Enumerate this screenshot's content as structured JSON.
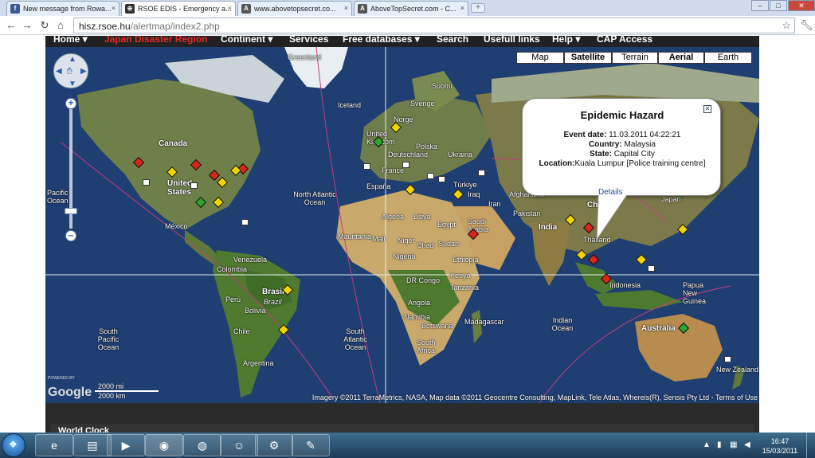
{
  "browser": {
    "tabs": [
      {
        "title": "New message from Rowa...",
        "active": false,
        "favicon_letter": "f",
        "favicon_color": "#3b5998"
      },
      {
        "title": "RSOE EDIS - Emergency a...",
        "active": true,
        "favicon_letter": "⊕",
        "favicon_color": "#333333"
      },
      {
        "title": "www.abovetopsecret.co...",
        "active": false,
        "favicon_letter": "A",
        "favicon_color": "#555555"
      },
      {
        "title": "AboveTopSecret.com - C...",
        "active": false,
        "favicon_letter": "A",
        "favicon_color": "#555555"
      }
    ],
    "new_tab_label": "+",
    "window_controls": {
      "minimize": "–",
      "maximize": "□",
      "close": "✕"
    },
    "url_host": "hisz.rsoe.hu",
    "url_path": "/alertmap/index2.php",
    "back_icon": "arrow-left-icon",
    "forward_icon": "arrow-right-icon",
    "reload_icon": "reload-icon",
    "home_icon": "home-icon"
  },
  "site_nav": [
    {
      "label": "Home ▾",
      "color": "#ffffff"
    },
    {
      "label": "Japan Disaster Region",
      "color": "#e32b2b"
    },
    {
      "label": "Continent ▾",
      "color": "#ffffff"
    },
    {
      "label": "Services",
      "color": "#ffffff"
    },
    {
      "label": "Free databases ▾",
      "color": "#ffffff"
    },
    {
      "label": "Search",
      "color": "#ffffff"
    },
    {
      "label": "Usefull links",
      "color": "#ffffff"
    },
    {
      "label": "Help ▾",
      "color": "#ffffff"
    },
    {
      "label": "CAP Access",
      "color": "#ffffff"
    }
  ],
  "map": {
    "map_types": [
      {
        "label": "Map",
        "active": false
      },
      {
        "label": "Satellite",
        "active": true
      },
      {
        "label": "Terrain",
        "active": false
      },
      {
        "label": "Aerial",
        "active": true
      },
      {
        "label": "Earth",
        "active": false
      }
    ],
    "zoom_in": "+",
    "zoom_out": "–",
    "places": {
      "greenland": "Greenland",
      "iceland": "Iceland",
      "sverige": "Sverige",
      "norge": "Norge",
      "suomi": "Suomi",
      "canada": "Canada",
      "united_kingdom": "United Kingdom",
      "deutschland": "Deutschland",
      "polska": "Polska",
      "ukraina": "Ukraina",
      "france": "France",
      "espana": "España",
      "turkiye": "Türkiye",
      "united_states": "United States",
      "pacific_ocean": "Pacific Ocean",
      "north_atlantic_ocean": "North Atlantic Ocean",
      "mexico": "México",
      "algeria": "Algeria",
      "libya": "Libya",
      "egypt": "Egypt",
      "saudi_arabia": "Saudi Arabia",
      "iraq": "Iraq",
      "iran": "Iran",
      "afghanistan": "Afghanistan",
      "pakistan": "Pakistan",
      "india": "India",
      "china": "China",
      "japan": "Japan",
      "mauritania": "Mauritania",
      "mali": "Mali",
      "niger": "Niger",
      "chad": "Chad",
      "sudan": "Sudan",
      "ethiopia": "Ethiopia",
      "nigeria": "Nigeria",
      "kenya": "Kenya",
      "tanzania": "Tanzania",
      "dr_congo": "DR Congo",
      "angola": "Angola",
      "namibia": "Namibia",
      "botswana": "Botswana",
      "south_africa": "South Africa",
      "madagascar": "Madagascar",
      "venezuela": "Venezuela",
      "colombia": "Colombia",
      "peru": "Perú",
      "bolivia": "Bolivia",
      "brasil": "Brasil",
      "brazil": "Brazil",
      "chile": "Chile",
      "argentina": "Argentina",
      "south_pacific_ocean": "South Pacific Ocean",
      "south_atlantic_ocean": "South Atlantic Ocean",
      "indian_ocean": "Indian Ocean",
      "thailand": "Thailand",
      "indonesia": "Indonesia",
      "papua_new_guinea": "Papua New Guinea",
      "australia": "Australia",
      "new_zealand": "New Zealand"
    },
    "infowindow": {
      "title": "Epidemic Hazard",
      "event_date_label": "Event date:",
      "event_date": "11.03.2011 04:22:21",
      "country_label": "Country:",
      "country": "Malaysia",
      "state_label": "State:",
      "state": "Capital City",
      "location_label": "Location:",
      "location": "Kuala Lumpur [Police training centre]",
      "details": "Details",
      "close_icon": "close-icon"
    },
    "markers": {
      "red": "#d8261c",
      "yellow": "#f2d500",
      "green": "#2fa52c",
      "info": "#ffffff"
    },
    "scale_top": "2000 mi",
    "scale_bottom": "2000 km",
    "powered_by": "POWERED BY",
    "google": "Google",
    "attribution": "Imagery ©2011 TerraMetrics, NASA, Map data ©2011 Geocentre Consulting, MapLink, Tele Atlas, Whereis(R), Sensis Pty Ltd - Terms of Use"
  },
  "below": {
    "world_clock": "World Clock"
  },
  "taskbar": {
    "start_icon": "windows-start-icon",
    "apps": [
      {
        "icon": "ie-icon",
        "glyph": "e"
      },
      {
        "icon": "explorer-icon",
        "glyph": "▤"
      },
      {
        "icon": "media-player-icon",
        "glyph": "▶"
      },
      {
        "icon": "chrome-icon",
        "glyph": "◉"
      },
      {
        "icon": "tor-icon",
        "glyph": "◍"
      },
      {
        "icon": "messenger-icon",
        "glyph": "☺"
      },
      {
        "icon": "steam-icon",
        "glyph": "⚙"
      },
      {
        "icon": "tool-icon",
        "glyph": "✎"
      }
    ],
    "time": "16:47",
    "date": "15/03/2011"
  }
}
